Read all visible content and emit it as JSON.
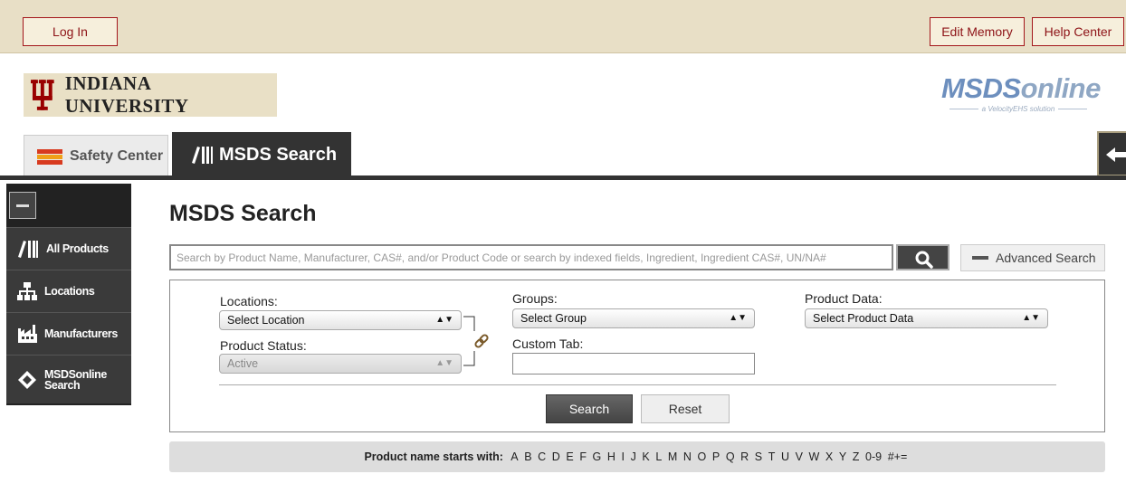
{
  "topbar": {
    "login_label": "Log In",
    "edit_memory_label": "Edit Memory",
    "help_center_label": "Help Center"
  },
  "branding": {
    "university_name": "INDIANA UNIVERSITY",
    "msds_logo_prefix": "MSDS",
    "msds_logo_suffix": "online",
    "msds_logo_tagline": "a VelocityEHS solution"
  },
  "tabs": [
    {
      "label": "Safety Center",
      "icon": "flag-icon",
      "active": false
    },
    {
      "label": "MSDS Search",
      "icon": "books-icon",
      "active": true
    }
  ],
  "sidebar": {
    "items": [
      {
        "label": "All Products",
        "icon": "books-icon"
      },
      {
        "label": "Locations",
        "icon": "hierarchy-icon"
      },
      {
        "label": "Manufacturers",
        "icon": "factory-icon"
      },
      {
        "label": "MSDSonline Search",
        "icon": "diamond-icon"
      }
    ]
  },
  "main": {
    "title": "MSDS Search",
    "search_placeholder": "Search by Product Name, Manufacturer, CAS#, and/or Product Code or search by indexed fields, Ingredient, Ingredient CAS#, UN/NA#",
    "advanced_search_label": "Advanced Search"
  },
  "filters": {
    "locations_label": "Locations:",
    "locations_value": "Select Location",
    "product_status_label": "Product Status:",
    "product_status_value": "Active",
    "groups_label": "Groups:",
    "groups_value": "Select Group",
    "custom_tab_label": "Custom Tab:",
    "custom_tab_value": "",
    "product_data_label": "Product Data:",
    "product_data_value": "Select Product Data",
    "search_button_label": "Search",
    "reset_button_label": "Reset"
  },
  "alphabet": {
    "label": "Product name starts with:",
    "letters": [
      "A",
      "B",
      "C",
      "D",
      "E",
      "F",
      "G",
      "H",
      "I",
      "J",
      "K",
      "L",
      "M",
      "N",
      "O",
      "P",
      "Q",
      "R",
      "S",
      "T",
      "U",
      "V",
      "W",
      "X",
      "Y",
      "Z",
      "0-9",
      "#+="
    ]
  },
  "colors": {
    "topbar_bg": "#e8dfc6",
    "iu_crimson": "#990000",
    "dark_nav": "#333333",
    "msds_blue": "#6d8fbe"
  }
}
